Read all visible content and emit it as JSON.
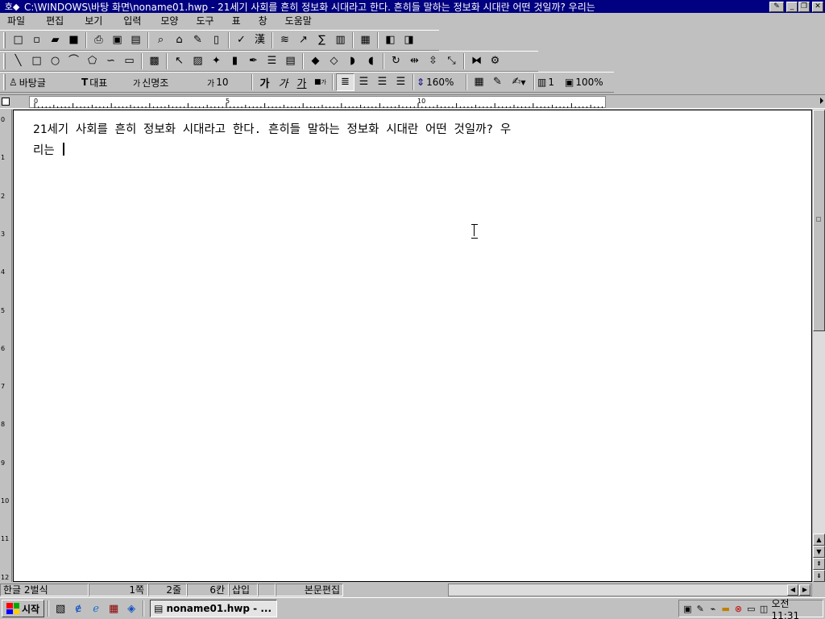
{
  "titlebar": {
    "title": "C:\\WINDOWS\\바탕 화면\\noname01.hwp - 21세기 사회를 흔히 정보화 시대라고 한다. 흔히들 말하는 정보화 시대란 어떤 것일까? 우리는",
    "app_icon": "hwp-app-icon",
    "buttons": [
      "minimize",
      "restore",
      "close"
    ]
  },
  "menubar": {
    "items": [
      "파일",
      "편집",
      "보기",
      "입력",
      "모양",
      "도구",
      "표",
      "창",
      "도움말"
    ]
  },
  "toolbar1": {
    "buttons": [
      {
        "name": "new-document-icon",
        "glyph": "□"
      },
      {
        "name": "new-window-icon",
        "glyph": "▫"
      },
      {
        "name": "open-folder-icon",
        "glyph": "▰"
      },
      {
        "name": "save-disk-icon",
        "glyph": "■"
      },
      {
        "name": "print-icon",
        "glyph": "⎙"
      },
      {
        "name": "print-preview-icon",
        "glyph": "▣"
      },
      {
        "name": "screen-icon",
        "glyph": "▤"
      },
      {
        "name": "zoom-icon",
        "glyph": "⌕"
      },
      {
        "name": "hanger-icon",
        "glyph": "⌂"
      },
      {
        "name": "pen-tool-icon",
        "glyph": "✎"
      },
      {
        "name": "page-icon",
        "glyph": "▯"
      },
      {
        "name": "check-grammar-icon",
        "glyph": "✓"
      },
      {
        "name": "hanja-icon",
        "glyph": "漢"
      },
      {
        "name": "line-draw-icon",
        "glyph": "≋"
      },
      {
        "name": "chart-icon",
        "glyph": "↗"
      },
      {
        "name": "formula-icon",
        "glyph": "∑"
      },
      {
        "name": "bar-chart-icon",
        "glyph": "▥"
      },
      {
        "name": "document-info-icon",
        "glyph": "▦"
      },
      {
        "name": "style-icon",
        "glyph": "◧"
      },
      {
        "name": "macro-icon",
        "glyph": "◨"
      }
    ]
  },
  "toolbar2": {
    "buttons": [
      {
        "name": "line-icon",
        "glyph": "╲"
      },
      {
        "name": "rectangle-icon",
        "glyph": "□"
      },
      {
        "name": "ellipse-icon",
        "glyph": "○"
      },
      {
        "name": "arc-icon",
        "glyph": "⌒"
      },
      {
        "name": "polygon-icon",
        "glyph": "⬠"
      },
      {
        "name": "curve-icon",
        "glyph": "∽"
      },
      {
        "name": "textbox-icon",
        "glyph": "▭"
      },
      {
        "name": "image-icon",
        "glyph": "▩"
      },
      {
        "name": "select-object-icon",
        "glyph": "↖"
      },
      {
        "name": "group-icon",
        "glyph": "▨"
      },
      {
        "name": "ungroup-icon",
        "glyph": "✦"
      },
      {
        "name": "font-color-icon",
        "glyph": "▮"
      },
      {
        "name": "paint-icon",
        "glyph": "✒"
      },
      {
        "name": "align-lines-icon",
        "glyph": "☰"
      },
      {
        "name": "object-list-icon",
        "glyph": "▤"
      },
      {
        "name": "bring-front-icon",
        "glyph": "◆"
      },
      {
        "name": "send-back-icon",
        "glyph": "◇"
      },
      {
        "name": "forward-icon",
        "glyph": "◗"
      },
      {
        "name": "backward-icon",
        "glyph": "◖"
      },
      {
        "name": "rotate-icon",
        "glyph": "↻"
      },
      {
        "name": "distribute-h-icon",
        "glyph": "⇹"
      },
      {
        "name": "distribute-v-icon",
        "glyph": "⇳"
      },
      {
        "name": "resize-icon",
        "glyph": "⤡"
      },
      {
        "name": "mirror-icon",
        "glyph": "⧓"
      },
      {
        "name": "object-properties-icon",
        "glyph": "⚙"
      }
    ]
  },
  "toolbar3": {
    "style": "바탕글",
    "font_type": "대표",
    "font_name": "신명조",
    "font_size": "10",
    "bold_glyph": "가",
    "italic_glyph": "가",
    "underline_glyph": "가",
    "char_glyph": "가",
    "line_spacing": "160%",
    "columns": "1",
    "zoom": "100%"
  },
  "ruler": {
    "labels": [
      "0",
      "5",
      "10"
    ]
  },
  "vruler": {
    "labels": [
      "0",
      "1",
      "2",
      "3",
      "4",
      "5",
      "6",
      "7",
      "8",
      "9",
      "10",
      "11",
      "12"
    ]
  },
  "document": {
    "line1": "21세기 사회를 흔히 정보화 시대라고 한다. 흔히들 말하는 정보화 시대란 어떤 것일까? 우",
    "line2": "리는 "
  },
  "statusbar": {
    "input_mode": "한글 2벌식",
    "page": "1쪽",
    "line": "2줄",
    "column": "6칸",
    "insert_mode": "삽입",
    "edit_mode": "본문편집"
  },
  "taskbar": {
    "start_label": "시작",
    "task_label": "noname01.hwp - ...",
    "clock": "오전 11:31"
  }
}
